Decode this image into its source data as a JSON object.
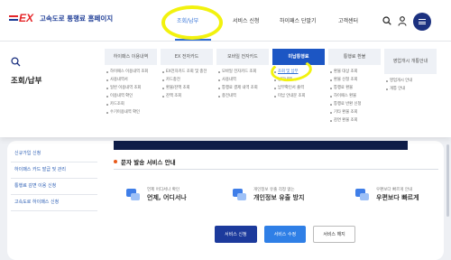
{
  "header": {
    "logo_text": "고속도로 통행료 홈페이지",
    "nav": [
      {
        "label": "조회/납부",
        "active": true
      },
      {
        "label": "서비스 신청",
        "active": false
      },
      {
        "label": "하이패스 단말기",
        "active": false
      },
      {
        "label": "고객센터",
        "active": false
      }
    ]
  },
  "mega_menu": {
    "title": "조회/납부",
    "columns": [
      {
        "heading": "하이패스 이용내역",
        "items": [
          "하이패스 이용내역 조회",
          "사용내역서",
          "일반 이용내역 조회",
          "이용내역 확인",
          "카드조회",
          "수기이용내역 확인"
        ]
      },
      {
        "heading": "EX 전자카드",
        "items": [
          "EX전자카드 조회 및 충전",
          "카드충전",
          "환불/잔액 조회",
          "잔액 조회"
        ]
      },
      {
        "heading": "모바일 전자카드",
        "items": [
          "모바일 전자카드 조회",
          "사용내역",
          "통행료 결제 내역 조회",
          "충전내역"
        ]
      },
      {
        "heading": "미납통행료",
        "active": true,
        "items": [
          "조회 및 납부",
          "납부내역",
          "납부확인서 출력",
          "미납 안내문 조회"
        ]
      },
      {
        "heading": "통행료 환불",
        "items": [
          "환불 대상 조회",
          "환불 신청 조회",
          "통행료 환불",
          "하이패스 환불",
          "통행료 반환 신청",
          "기타 환불 조회",
          "감면 환불 조회"
        ]
      },
      {
        "heading": "영업개시 개통안내",
        "items": [
          "영업개시 안내",
          "개통 안내"
        ]
      }
    ]
  },
  "left_nav": [
    "신규가입 신청",
    "하이패스 카드 발급 및 관리",
    "통행료 감면 이용 신청",
    "고속도로 하이패스 신청"
  ],
  "section": {
    "title": "문자 발송 서비스 안내"
  },
  "services": [
    {
      "sub": "언제 어디서나 확인",
      "title": "언제, 어디서나"
    },
    {
      "sub": "개인정보 유출 걱정 없는",
      "title": "개인정보 유출 방지"
    },
    {
      "sub": "우편보다 빠르게 안내",
      "title": "우편보다 빠르게"
    }
  ],
  "buttons": [
    "서비스 신청",
    "서비스 수정",
    "서비스 해지"
  ]
}
